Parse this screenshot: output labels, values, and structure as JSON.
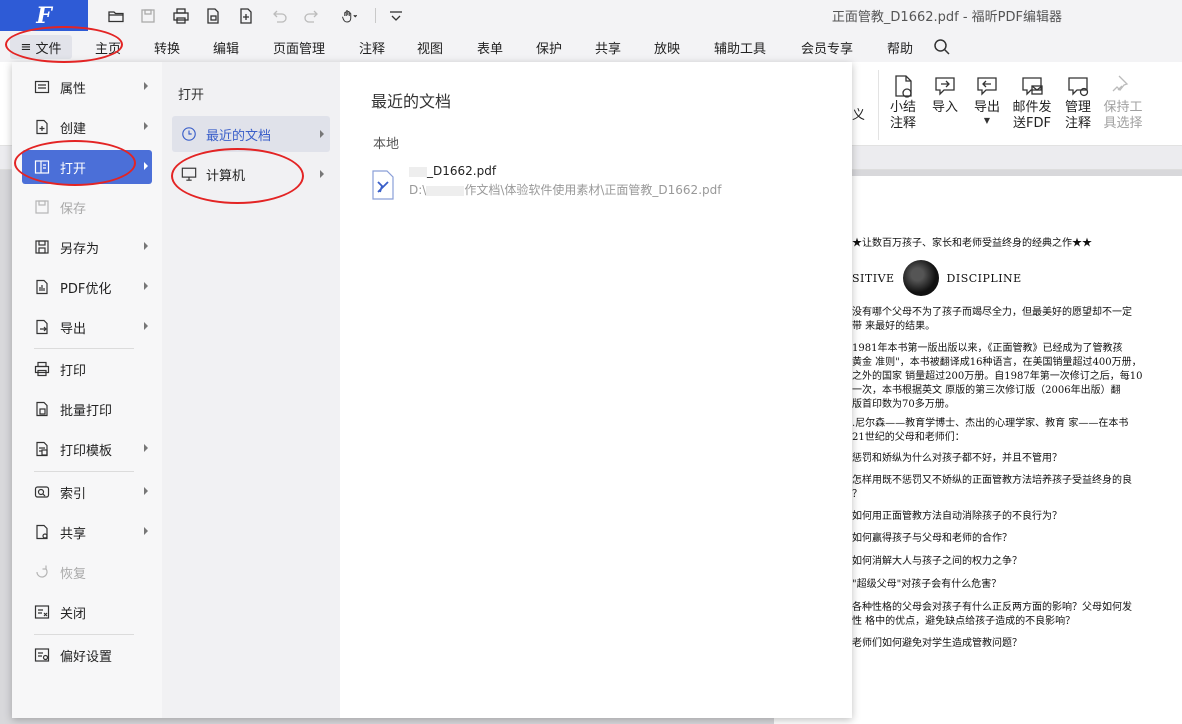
{
  "app": {
    "logo_letter": "F",
    "doc_title": "正面管教_D1662.pdf - 福昕PDF编辑器"
  },
  "quick_access": [
    "open-folder-icon",
    "save-icon",
    "print-icon",
    "new-file-icon",
    "add-page-icon",
    "undo-icon",
    "redo-icon",
    "hand-tool-icon",
    "more-chevron-icon"
  ],
  "menu": {
    "file": "文件",
    "items": [
      "主页",
      "转换",
      "编辑",
      "页面管理",
      "注释",
      "视图",
      "表单",
      "保护",
      "共享",
      "放映",
      "辅助工具",
      "会员专享",
      "帮助"
    ]
  },
  "ribbon": {
    "partial_label_top": "义",
    "partial_label_bottom": "",
    "buttons": [
      {
        "label": "小结\n注释",
        "icon": "summary-comment-icon"
      },
      {
        "label": "导入",
        "icon": "import-icon"
      },
      {
        "label": "导出",
        "icon": "export-icon"
      },
      {
        "label": "邮件发\n送FDF",
        "icon": "email-fdf-icon"
      },
      {
        "label": "管理\n注释",
        "icon": "manage-comment-icon"
      },
      {
        "label": "保持工\n具选择",
        "icon": "keep-tool-icon"
      }
    ]
  },
  "backstage": {
    "left_menu": [
      {
        "label": "属性",
        "icon": "properties-icon",
        "arrow": true
      },
      {
        "label": "创建",
        "icon": "create-icon",
        "arrow": true
      },
      {
        "label": "打开",
        "icon": "open-icon",
        "arrow": true,
        "active": true
      },
      {
        "label": "保存",
        "icon": "save-icon",
        "arrow": false,
        "disabled": true
      },
      {
        "label": "另存为",
        "icon": "save-as-icon",
        "arrow": true
      },
      {
        "label": "PDF优化",
        "icon": "pdf-optimize-icon",
        "arrow": true
      },
      {
        "label": "导出",
        "icon": "export-icon",
        "arrow": true
      },
      {
        "label": "打印",
        "icon": "print-icon",
        "arrow": false
      },
      {
        "label": "批量打印",
        "icon": "batch-print-icon",
        "arrow": false
      },
      {
        "label": "打印模板",
        "icon": "print-template-icon",
        "arrow": true
      },
      {
        "label": "索引",
        "icon": "index-icon",
        "arrow": true
      },
      {
        "label": "共享",
        "icon": "share-icon",
        "arrow": true
      },
      {
        "label": "恢复",
        "icon": "restore-icon",
        "arrow": false,
        "disabled": true
      },
      {
        "label": "关闭",
        "icon": "close-doc-icon",
        "arrow": false
      },
      {
        "label": "偏好设置",
        "icon": "preferences-icon",
        "arrow": false
      }
    ],
    "open_panel": {
      "title": "打开",
      "items": [
        {
          "label": "最近的文档",
          "icon": "clock-icon",
          "selected": true
        },
        {
          "label": "计算机",
          "icon": "computer-icon",
          "selected": false
        }
      ]
    },
    "recent": {
      "title": "最近的文档",
      "section": "本地",
      "files": [
        {
          "name_visible": "正面管教_D1662.pdf",
          "path_visible": "D:\\体验软件使用素材\\正面管教_D1662.pdf",
          "name_suffix": "_D1662.pdf",
          "path_prefix": "D:\\",
          "path_suffix": "作文档\\体验软件使用素材\\正面管教_D1662.pdf"
        }
      ]
    }
  },
  "page_content": {
    "banner": "★让数百万孩子、家长和老师受益终身的经典之作★★",
    "brand_left": "SITIVE",
    "brand_right": "DISCIPLINE",
    "lines": [
      "没有哪个父母不为了孩子而竭尽全力，但最美好的愿望却不一定",
      "带 来最好的结果。",
      "1981年本书第一版出版以来，《正面管教》已经成为了管教孩",
      "黄金 准则\"，本书被翻译成16种语言，在美国销量超过400万册，",
      "之外的国家 销量超过200万册。自1987年第一次修订之后，每10",
      "一次，本书根据英文 原版的第三次修订版（2006年出版）翻",
      "版首印数为70多万册。",
      ".尼尔森——教育学博士、杰出的心理学家、教育 家——在本书",
      "21世纪的父母和老师们：",
      "惩罚和娇纵为什么对孩子都不好，并且不管用？",
      "怎样用既不惩罚又不娇纵的正面管教方法培养孩子受益终身的良",
      "？",
      "如何用正面管教方法自动消除孩子的不良行为？",
      "如何赢得孩子与父母和老师的合作？",
      "如何消解大人与孩子之间的权力之争？",
      "\"超级父母\"对孩子会有什么危害？",
      "各种性格的父母会对孩子有什么正反两方面的影响？父母如何发",
      "性 格中的优点，避免缺点给孩子造成的不良影响？",
      "老师们如何避免对学生造成管教问题？"
    ]
  },
  "colors": {
    "accent": "#4b6fd8",
    "logo_bg": "#2e5bd6",
    "annotation": "#e32424"
  }
}
